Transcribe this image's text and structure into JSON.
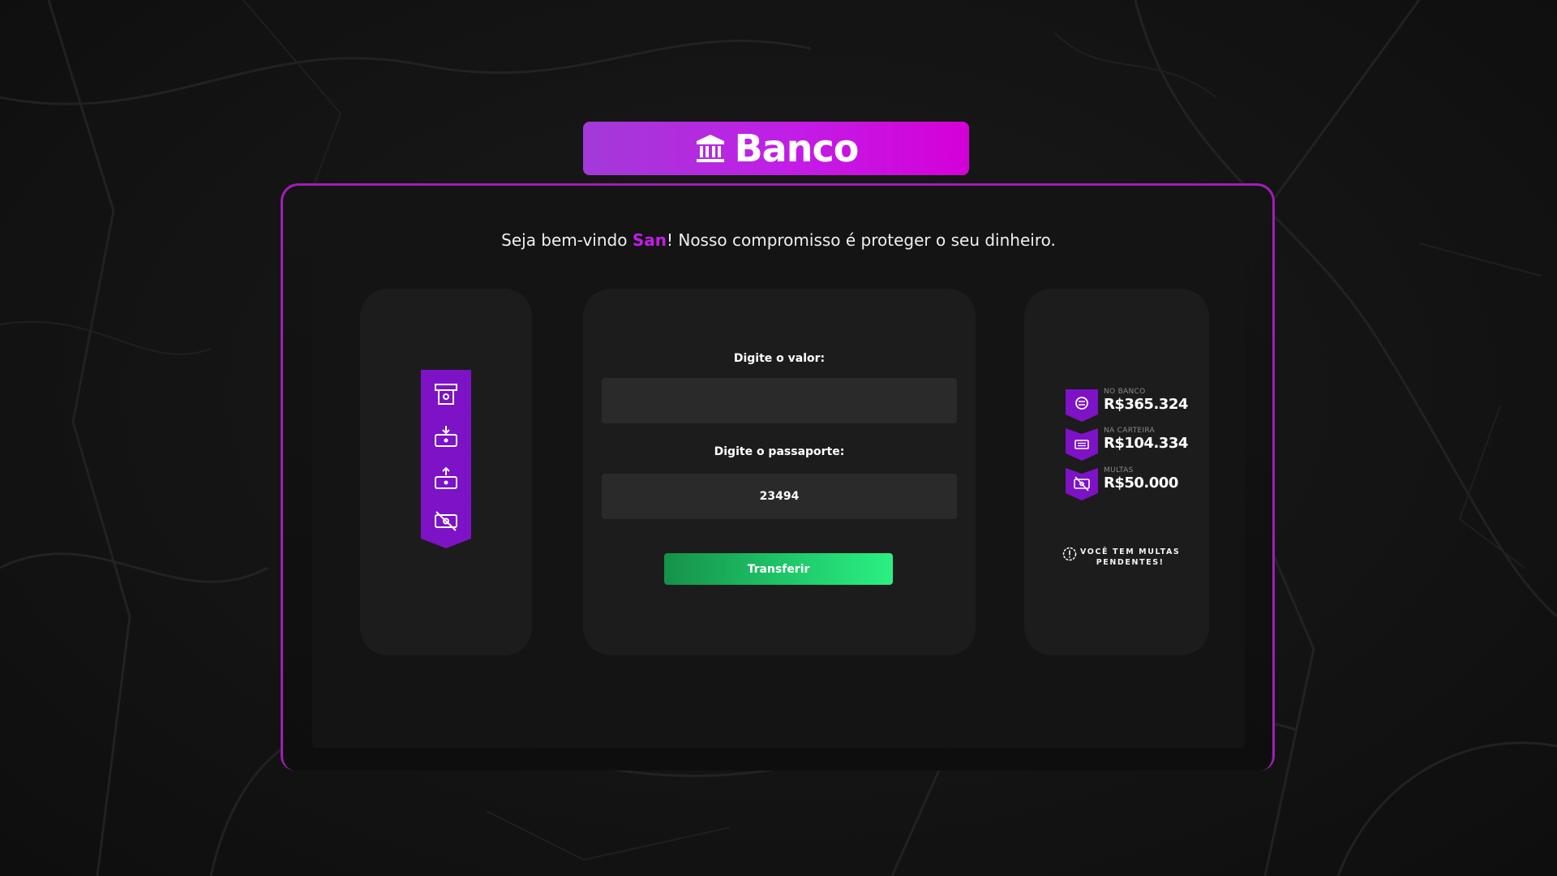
{
  "header": {
    "title": "Banco",
    "icon": "bank-icon"
  },
  "welcome": {
    "prefix": "Seja bem-vindo ",
    "user_name": "San",
    "suffix": "! Nosso compromisso é proteger o seu dinheiro."
  },
  "actions": [
    {
      "name": "atm",
      "icon": "atm-icon"
    },
    {
      "name": "deposit",
      "icon": "deposit-icon"
    },
    {
      "name": "withdraw",
      "icon": "withdraw-icon"
    },
    {
      "name": "fines",
      "icon": "no-money-icon"
    }
  ],
  "form": {
    "amount_label": "Digite o valor:",
    "amount_value": "",
    "passport_label": "Digite o passaporte:",
    "passport_value": "23494",
    "submit_label": "Transferir"
  },
  "balances": [
    {
      "label": "NO BANCO",
      "value": "R$365.324",
      "icon": "coin-icon"
    },
    {
      "label": "NA CARTEIRA",
      "value": "R$104.334",
      "icon": "wallet-icon"
    },
    {
      "label": "MULTAS",
      "value": "R$50.000",
      "icon": "no-money-icon"
    }
  ],
  "warning": {
    "icon": "alert-icon",
    "line1": "VOCÊ TEM MULTAS",
    "line2": "PENDENTES!"
  },
  "colors": {
    "accent": "#c21de6",
    "frame": "#a21db8",
    "success": "#1fc86a",
    "card": "#1c1c1c",
    "input": "#2a2a2a"
  }
}
